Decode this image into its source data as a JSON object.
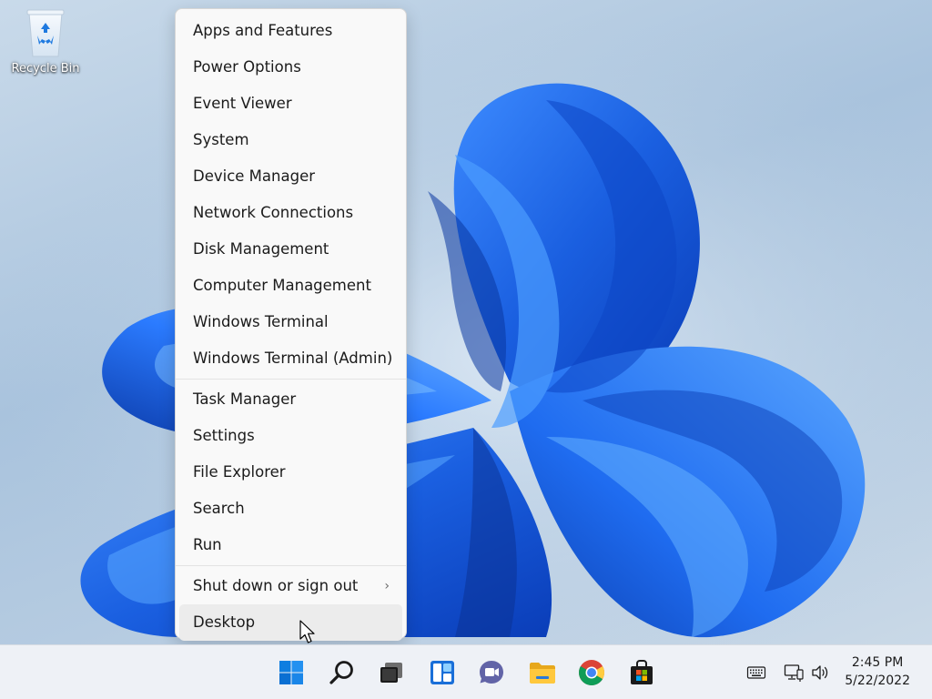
{
  "desktop": {
    "icons": [
      {
        "label": "Recycle Bin",
        "icon": "recycle-bin-icon"
      }
    ]
  },
  "menu": {
    "groups": [
      [
        "Apps and Features",
        "Power Options",
        "Event Viewer",
        "System",
        "Device Manager",
        "Network Connections",
        "Disk Management",
        "Computer Management",
        "Windows Terminal",
        "Windows Terminal (Admin)"
      ],
      [
        "Task Manager",
        "Settings",
        "File Explorer",
        "Search",
        "Run"
      ],
      [
        "Shut down or sign out",
        "Desktop"
      ]
    ],
    "submenu_indicator": "›",
    "hovered_item": "Desktop"
  },
  "taskbar": {
    "apps": [
      "start-icon",
      "search-icon",
      "task-view-icon",
      "widgets-icon",
      "teams-chat-icon",
      "file-explorer-icon",
      "chrome-icon",
      "microsoft-store-icon"
    ],
    "tray": [
      "keyboard-icon",
      "network-icon",
      "volume-icon"
    ],
    "clock": {
      "time": "2:45 PM",
      "date": "5/22/2022"
    }
  },
  "colors": {
    "accent": "#0067c0",
    "wallpaper_blue": "#1a73e8",
    "menu_bg": "#f9f9f9",
    "taskbar_bg": "#eef1f6"
  }
}
